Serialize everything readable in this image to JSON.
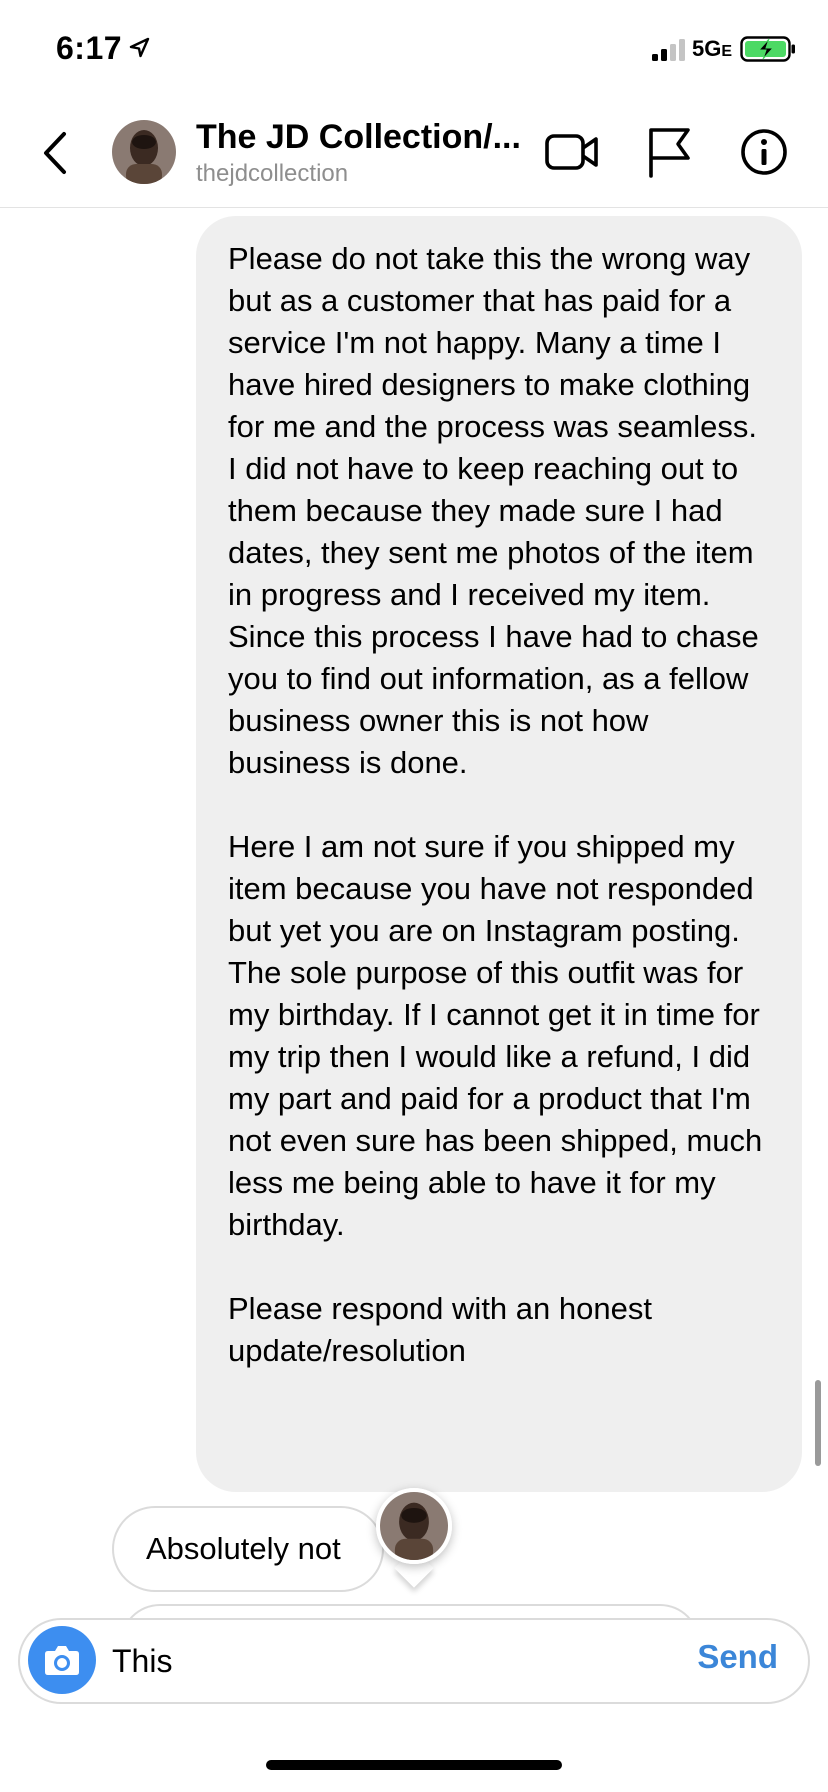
{
  "status_bar": {
    "time": "6:17",
    "network": "5G",
    "network_suffix": "E",
    "battery_charging": true,
    "icons": [
      "location-arrow-icon",
      "signal-icon",
      "battery-icon"
    ]
  },
  "header": {
    "name": "The JD Collection/...",
    "handle": "thejdcollection",
    "icons": [
      "back-chevron-icon",
      "video-call-icon",
      "flag-icon",
      "info-icon"
    ]
  },
  "message": {
    "paragraphs": [
      "Please do not take this the wrong way but as a customer that has paid for a service I'm not happy. Many a time I have hired designers to make clothing for me and the process was seamless. I did not have to keep reaching out to them because they made sure I had dates, they sent me photos of the item in progress and I received my item. Since this process I have had to chase you to find out information, as a fellow business owner this is not how business is done.",
      "Here I am not sure if you shipped my item because you have not responded but yet you are on Instagram posting. The sole purpose of this outfit was for my birthday. If I cannot get it in time for my trip then I would like a refund, I did my part and paid for a product that I'm not even sure has been shipped, much less me being able to have it for my birthday.",
      "Please respond with an honest update/resolution"
    ]
  },
  "reply": {
    "text": "Absolutely not"
  },
  "composer": {
    "value": "This",
    "send_label": "Send",
    "icon": "camera-icon"
  },
  "colors": {
    "bubble_bg": "#efefef",
    "send_blue": "#3b86d8",
    "camera_blue": "#3d8ef0",
    "handle_gray": "#8e8e8e"
  }
}
